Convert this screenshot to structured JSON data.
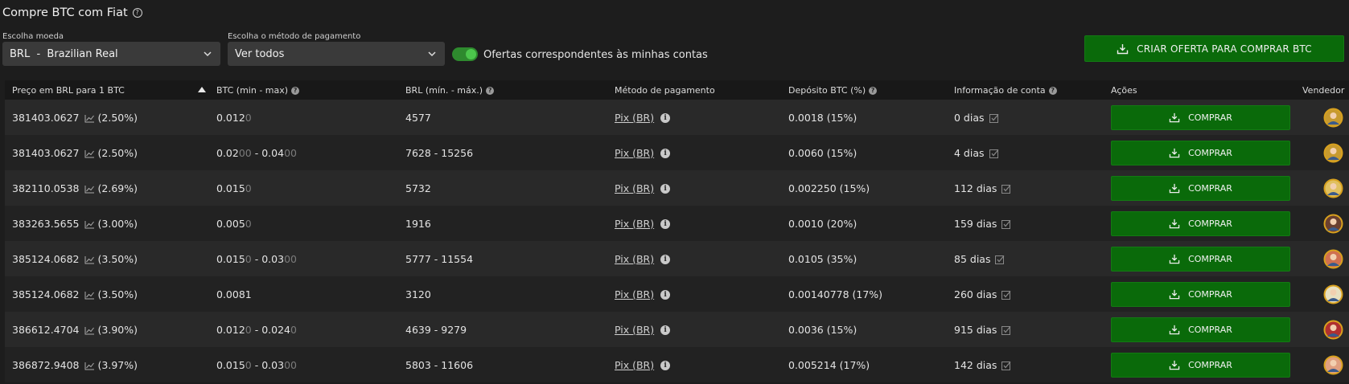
{
  "header": {
    "title": "Compre BTC com Fiat"
  },
  "currency": {
    "label": "Escolha moeda",
    "value": "BRL  -  Brazilian Real"
  },
  "payment": {
    "label": "Escolha o método de pagamento",
    "value": "Ver todos"
  },
  "toggle": {
    "label": "Ofertas correspondentes às minhas contas",
    "on": true
  },
  "create_button": {
    "label": "CRIAR OFERTA PARA COMPRAR BTC"
  },
  "columns": {
    "price": "Preço em BRL para 1 BTC",
    "btc": "BTC (min - max)",
    "brl": "BRL (mín. - máx.)",
    "method": "Método de pagamento",
    "deposit": "Depósito BTC (%)",
    "account": "Informação de conta",
    "actions": "Ações",
    "seller": "Vendedor"
  },
  "rows": [
    {
      "price": "381403.0627",
      "pct": "(2.50%)",
      "btc_min": "0.012",
      "btc_min_dim": "0",
      "btc_max": "",
      "btc_max_dim": "",
      "brl": "4577",
      "method": "Pix (BR)",
      "deposit": "0.0018 (15%)",
      "account": "0 dias",
      "action": "COMPRAR",
      "avatar_color": "#c79a2f"
    },
    {
      "price": "381403.0627",
      "pct": "(2.50%)",
      "btc_min": "0.02",
      "btc_min_dim": "00",
      "btc_max": "0.04",
      "btc_max_dim": "00",
      "brl": "7628 - 15256",
      "method": "Pix (BR)",
      "deposit": "0.0060 (15%)",
      "account": "4 dias",
      "action": "COMPRAR",
      "avatar_color": "#c79a2f"
    },
    {
      "price": "382110.0538",
      "pct": "(2.69%)",
      "btc_min": "0.015",
      "btc_min_dim": "0",
      "btc_max": "",
      "btc_max_dim": "",
      "brl": "5732",
      "method": "Pix (BR)",
      "deposit": "0.002250 (15%)",
      "account": "112 dias",
      "action": "COMPRAR",
      "avatar_color": "#e0c060"
    },
    {
      "price": "383263.5655",
      "pct": "(3.00%)",
      "btc_min": "0.005",
      "btc_min_dim": "0",
      "btc_max": "",
      "btc_max_dim": "",
      "brl": "1916",
      "method": "Pix (BR)",
      "deposit": "0.0010 (20%)",
      "account": "159 dias",
      "action": "COMPRAR",
      "avatar_color": "#6a4030"
    },
    {
      "price": "385124.0682",
      "pct": "(3.50%)",
      "btc_min": "0.015",
      "btc_min_dim": "0",
      "btc_max": "0.03",
      "btc_max_dim": "00",
      "brl": "5777 - 11554",
      "method": "Pix (BR)",
      "deposit": "0.0105 (35%)",
      "account": "85 dias",
      "action": "COMPRAR",
      "avatar_color": "#d07050"
    },
    {
      "price": "385124.0682",
      "pct": "(3.50%)",
      "btc_min": "0.0081",
      "btc_min_dim": "",
      "btc_max": "",
      "btc_max_dim": "",
      "brl": "3120",
      "method": "Pix (BR)",
      "deposit": "0.00140778 (17%)",
      "account": "260 dias",
      "action": "COMPRAR",
      "avatar_color": "#e8e0c0"
    },
    {
      "price": "386612.4704",
      "pct": "(3.90%)",
      "btc_min": "0.012",
      "btc_min_dim": "0",
      "btc_max": "0.024",
      "btc_max_dim": "0",
      "brl": "4639 - 9279",
      "method": "Pix (BR)",
      "deposit": "0.0036 (15%)",
      "account": "915 dias",
      "action": "COMPRAR",
      "avatar_color": "#b03030"
    },
    {
      "price": "386872.9408",
      "pct": "(3.97%)",
      "btc_min": "0.015",
      "btc_min_dim": "0",
      "btc_max": "0.03",
      "btc_max_dim": "00",
      "brl": "5803 - 11606",
      "method": "Pix (BR)",
      "deposit": "0.005214 (17%)",
      "account": "142 dias",
      "action": "COMPRAR",
      "avatar_color": "#e0a080"
    }
  ]
}
